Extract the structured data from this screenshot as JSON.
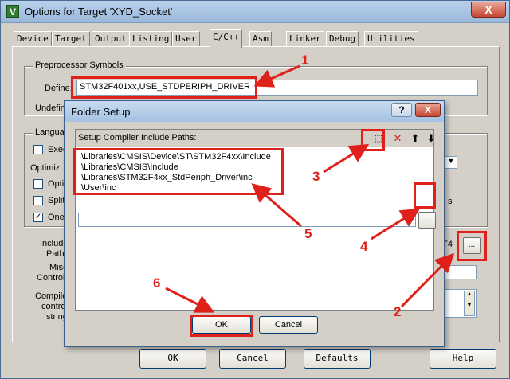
{
  "window": {
    "icon_glyph": "V",
    "title": "Options for Target 'XYD_Socket'",
    "close_glyph": "X"
  },
  "tabs": [
    "Device",
    "Target",
    "Output",
    "Listing",
    "User",
    "C/C++",
    "Asm",
    "Linker",
    "Debug",
    "Utilities"
  ],
  "active_tab": "C/C++",
  "preprocessor": {
    "group_label": "Preprocessor Symbols",
    "define_label": "Define:",
    "define_value": "STM32F401xx,USE_STDPERIPH_DRIVER",
    "undefine_label": "Undefin"
  },
  "language": {
    "group_label": "Languag",
    "exec_label": "Exec",
    "optimiz_label": "Optimiz",
    "opti_label": "Optir",
    "split_label": "Split",
    "one_label": "One"
  },
  "include": {
    "include_label": "Include",
    "paths_label": "Paths",
    "misc_label": "Misc",
    "controls_label": "Controls",
    "compiler_label": "Compile",
    "control_label": "contro",
    "string_label": "string",
    "path_partial": "2F4",
    "ellipsis": "..."
  },
  "bottom_buttons": {
    "ok": "OK",
    "cancel": "Cancel",
    "defaults": "Defaults",
    "help": "Help"
  },
  "folder_setup": {
    "title": "Folder Setup",
    "help_glyph": "?",
    "close_glyph": "X",
    "list_header": "Setup Compiler Include Paths:",
    "paths": [
      ".\\Libraries\\CMSIS\\Device\\ST\\STM32F4xx\\Include",
      ".\\Libraries\\CMSIS\\Include",
      ".\\Libraries\\STM32F4xx_StdPeriph_Driver\\inc",
      ".\\User\\inc"
    ],
    "edit_value": "",
    "ellipsis": "...",
    "ok": "OK",
    "cancel": "Cancel"
  },
  "annotations": [
    "1",
    "2",
    "3",
    "4",
    "5",
    "6"
  ],
  "colors": {
    "annotation_red": "#e0201b",
    "window_bg": "#d4d0c8",
    "title_blue": "#9ab8da"
  }
}
